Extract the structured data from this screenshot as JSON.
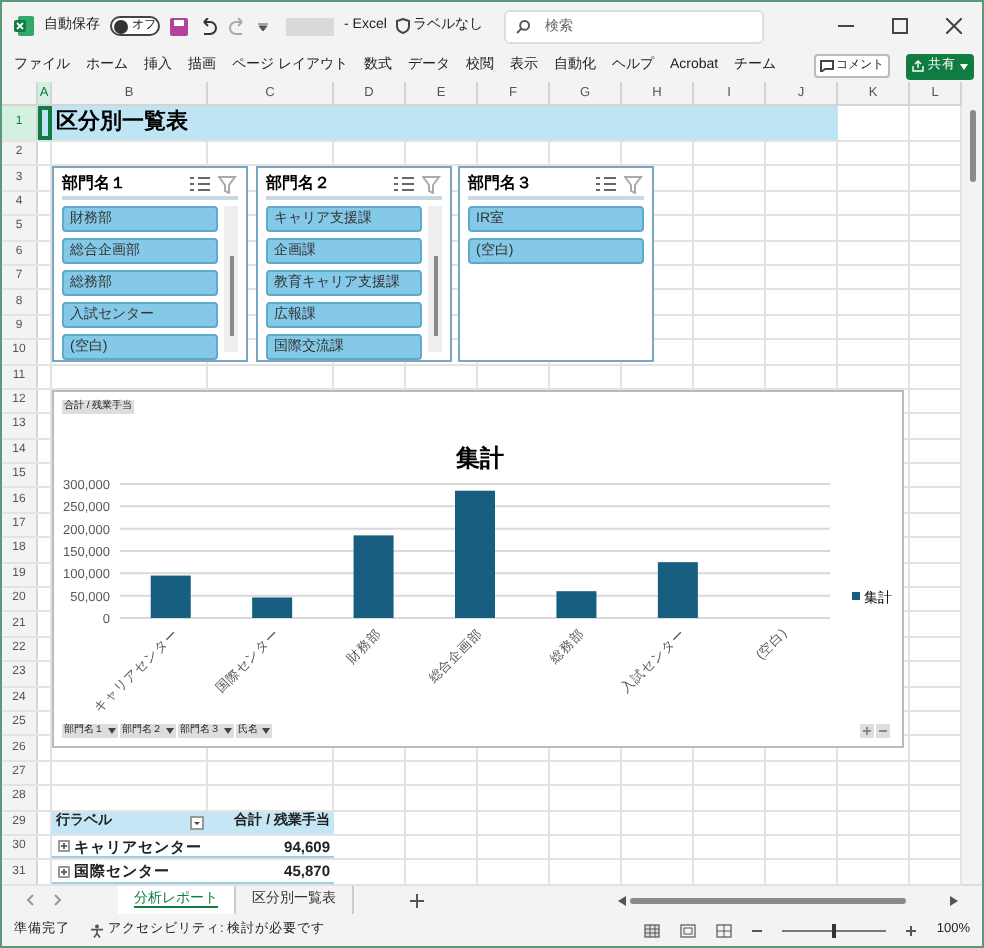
{
  "title_bar": {
    "autosave_label": "自動保存",
    "autosave_on": false,
    "autosave_state": "オフ",
    "app_name": "- Excel",
    "sensitivity": "ラベルなし",
    "search": {
      "placeholder": "検索"
    }
  },
  "ribbon_tabs": [
    "ファイル",
    "ホーム",
    "挿入",
    "描画",
    "ページ レイアウト",
    "数式",
    "データ",
    "校閲",
    "表示",
    "自動化",
    "ヘルプ",
    "Acrobat",
    "チーム"
  ],
  "ribbon_buttons": {
    "comment": "コメント",
    "share": "共有"
  },
  "columns": [
    "A",
    "B",
    "C",
    "D",
    "E",
    "F",
    "G",
    "H",
    "I",
    "J",
    "K",
    "L"
  ],
  "rows": [
    "1",
    "2",
    "3",
    "4",
    "5",
    "6",
    "7",
    "8",
    "9",
    "10",
    "11",
    "12",
    "13",
    "14",
    "15",
    "16",
    "17",
    "18",
    "19",
    "20",
    "21",
    "22",
    "23",
    "24",
    "25",
    "26",
    "27",
    "28",
    "29",
    "30",
    "31"
  ],
  "sheet_title": "区分別一覧表",
  "slicers": [
    {
      "title": "部門名１",
      "scrollable": true,
      "items": [
        {
          "label": "財務部",
          "selected": true
        },
        {
          "label": "総合企画部",
          "selected": true
        },
        {
          "label": "総務部",
          "selected": true
        },
        {
          "label": "入試センター",
          "selected": true
        },
        {
          "label": "(空白)",
          "selected": true
        }
      ]
    },
    {
      "title": "部門名２",
      "scrollable": true,
      "items": [
        {
          "label": "キャリア支援課",
          "selected": true
        },
        {
          "label": "企画課",
          "selected": true
        },
        {
          "label": "教育キャリア支援課",
          "selected": true
        },
        {
          "label": "広報課",
          "selected": true
        },
        {
          "label": "国際交流課",
          "selected": true
        }
      ]
    },
    {
      "title": "部門名３",
      "scrollable": false,
      "items": [
        {
          "label": "IR室",
          "selected": true
        },
        {
          "label": "(空白)",
          "selected": true
        }
      ]
    }
  ],
  "chart": {
    "value_field_button": "合計 / 残業手当",
    "axis_field_buttons": [
      "部門名１",
      "部門名２",
      "部門名３",
      "氏名"
    ],
    "chart_data": {
      "type": "bar",
      "title": "集計",
      "categories": [
        "キャリアセンター",
        "国際センター",
        "財務部",
        "総合企画部",
        "総務部",
        "入試センター",
        "(空白)"
      ],
      "series": [
        {
          "name": "集計",
          "color": "#175e80",
          "values": [
            95000,
            46000,
            185000,
            285000,
            60000,
            125000,
            0
          ]
        }
      ],
      "grid": true,
      "ylim": [
        0,
        300000
      ],
      "yticks": [
        {
          "value": 0,
          "label": "0"
        },
        {
          "value": 50000,
          "label": "50,000"
        },
        {
          "value": 100000,
          "label": "100,000"
        },
        {
          "value": 150000,
          "label": "150,000"
        },
        {
          "value": 200000,
          "label": "200,000"
        },
        {
          "value": 250000,
          "label": "250,000"
        },
        {
          "value": 300000,
          "label": "300,000"
        }
      ]
    }
  },
  "pivot": {
    "columns": [
      "行ラベル",
      "合計 / 残業手当"
    ],
    "rows": [
      {
        "label": "キャリアセンター",
        "value": "94,609"
      },
      {
        "label": "国際センター",
        "value": "45,870"
      }
    ]
  },
  "sheet_tabs": [
    {
      "label": "分析レポート",
      "selected": true
    },
    {
      "label": "区分別一覧表",
      "selected": false
    }
  ],
  "status_bar": {
    "ready": "準備完了",
    "accessibility": "アクセシビリティ: 検討が必要です",
    "zoom": "100%",
    "level": 0.5
  }
}
